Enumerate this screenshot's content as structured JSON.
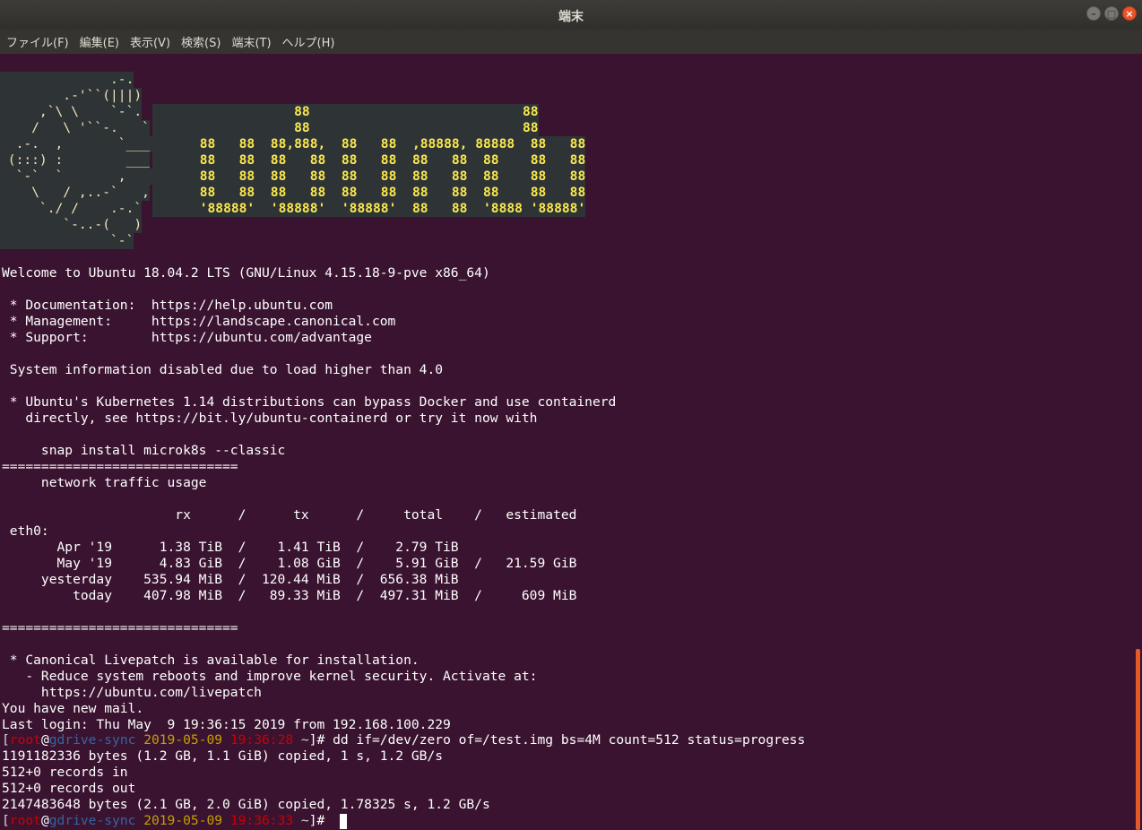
{
  "window": {
    "title": "端末",
    "controls": {
      "minimize_icon": "–",
      "maximize_icon": "□",
      "close_icon": "×"
    }
  },
  "menu": [
    "ファイル(F)",
    "編集(E)",
    "表示(V)",
    "検索(S)",
    "端末(T)",
    "ヘルプ(H)"
  ],
  "logo": {
    "left": [
      "              .-.",
      "        .-'``(|||)",
      "     ,`\\ \\    `-`.",
      "    /   \\ '``-.   `",
      "  .-.  ,       `___:",
      " (:::) :        ___",
      "  `-`  `       ,   :",
      "    \\   / ,..-`   ,",
      "     `./ /    .-.`",
      "        `-..-(   )",
      "              `-`"
    ],
    "right": [
      "",
      "",
      "                  88                           88",
      "                  88                           88",
      "      88   88  88,888,  88   88  ,88888, 88888  88   88",
      "      88   88  88   88  88   88  88   88  88    88   88",
      "      88   88  88   88  88   88  88   88  88    88   88",
      "      88   88  88   88  88   88  88   88  88    88   88",
      "      '88888'  '88888'  '88888'  88   88  '8888 '88888'",
      "",
      ""
    ]
  },
  "output": [
    "",
    "Welcome to Ubuntu 18.04.2 LTS (GNU/Linux 4.15.18-9-pve x86_64)",
    "",
    " * Documentation:  https://help.ubuntu.com",
    " * Management:     https://landscape.canonical.com",
    " * Support:        https://ubuntu.com/advantage",
    "",
    " System information disabled due to load higher than 4.0",
    "",
    " * Ubuntu's Kubernetes 1.14 distributions can bypass Docker and use containerd",
    "   directly, see https://bit.ly/ubuntu-containerd or try it now with",
    "",
    "     snap install microk8s --classic",
    "==============================",
    "     network traffic usage",
    "",
    "                      rx      /      tx      /     total    /   estimated",
    " eth0:",
    "       Apr '19      1.38 TiB  /    1.41 TiB  /    2.79 TiB",
    "       May '19      4.83 GiB  /    1.08 GiB  /    5.91 GiB  /   21.59 GiB",
    "     yesterday    535.94 MiB  /  120.44 MiB  /  656.38 MiB",
    "         today    407.98 MiB  /   89.33 MiB  /  497.31 MiB  /     609 MiB",
    "",
    "==============================",
    "",
    " * Canonical Livepatch is available for installation.",
    "   - Reduce system reboots and improve kernel security. Activate at:",
    "     https://ubuntu.com/livepatch",
    "You have new mail.",
    "Last login: Thu May  9 19:36:15 2019 from 192.168.100.229"
  ],
  "prompt1": {
    "open": "[",
    "user": "root",
    "at": "@",
    "host": "gdrive-sync",
    "date": " 2019-05-09",
    "time": " 19:36:28",
    "dir": " ~",
    "close": "]# ",
    "command": "dd if=/dev/zero of=/test.img bs=4M count=512 status=progress"
  },
  "dd_output": [
    "1191182336 bytes (1.2 GB, 1.1 GiB) copied, 1 s, 1.2 GB/s",
    "512+0 records in",
    "512+0 records out",
    "2147483648 bytes (2.1 GB, 2.0 GiB) copied, 1.78325 s, 1.2 GB/s"
  ],
  "prompt2": {
    "open": "[",
    "user": "root",
    "at": "@",
    "host": "gdrive-sync",
    "date": " 2019-05-09",
    "time": " 19:36:33",
    "dir": " ~",
    "close": "]# ",
    "command": ""
  }
}
